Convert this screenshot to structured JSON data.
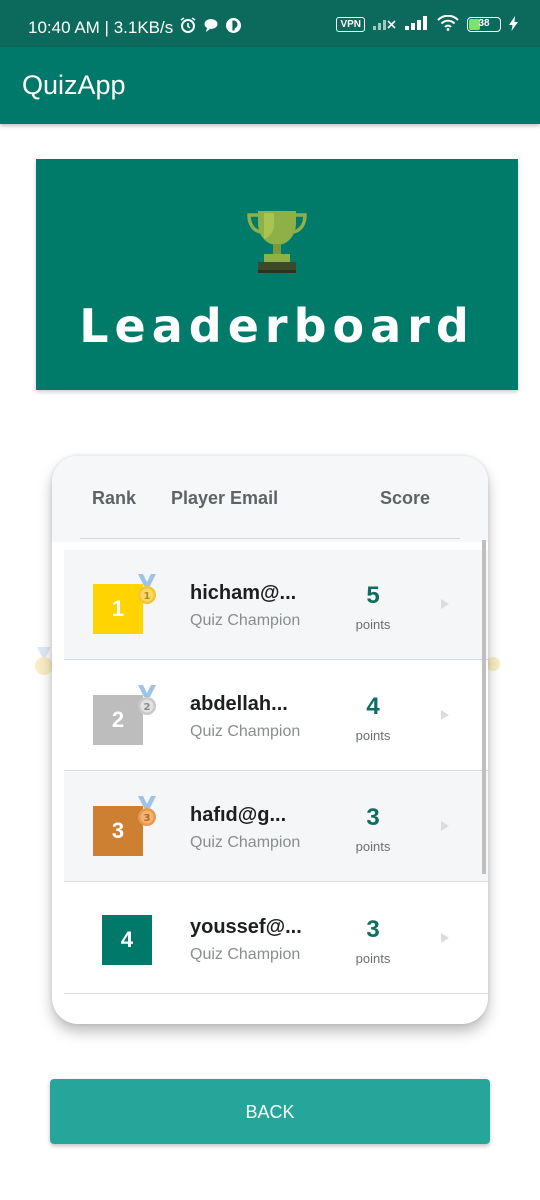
{
  "status_bar": {
    "time_speed": "10:40 AM | 3.1KB/s",
    "vpn": "VPN",
    "battery": "38"
  },
  "app": {
    "title": "QuizApp"
  },
  "banner": {
    "heading": "Leaderboard",
    "icon": "trophy-icon"
  },
  "table": {
    "columns": [
      "Rank",
      "Player Email",
      "Score"
    ],
    "rows": [
      {
        "rank": "1",
        "email": "hicham@...",
        "role": "Quiz Champion",
        "score": "5",
        "points": "points",
        "rank_color": "#ffd400",
        "medal": "1"
      },
      {
        "rank": "2",
        "email": "abdellah...",
        "role": "Quiz Champion",
        "score": "4",
        "points": "points",
        "rank_color": "#bdbdbd",
        "medal": "2"
      },
      {
        "rank": "3",
        "email": "hafıd@g...",
        "role": "Quiz Champion",
        "score": "3",
        "points": "points",
        "rank_color": "#cd7f32",
        "medal": "3"
      },
      {
        "rank": "4",
        "email": "youssef@...",
        "role": "Quiz Champion",
        "score": "3",
        "points": "points",
        "rank_color": "#00796b"
      }
    ]
  },
  "back_label": "BACK",
  "colors": {
    "primary": "#00796b",
    "status_bar": "#0b6a5c",
    "button": "#26a69a"
  }
}
